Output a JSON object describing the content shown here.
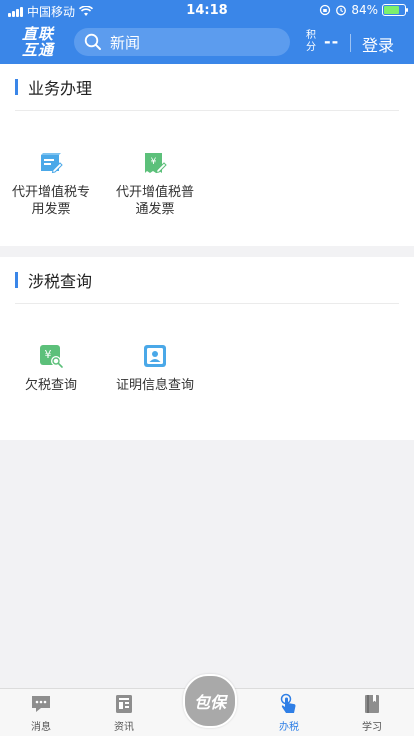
{
  "status_bar": {
    "carrier": "中国移动",
    "time": "14:18",
    "battery": "84%",
    "battery_level": 0.84
  },
  "app_bar": {
    "logo_line1": "直联",
    "logo_line2": "互通",
    "search_placeholder": "新闻",
    "points_label": "积分",
    "points_value": "--",
    "login_label": "登录"
  },
  "sections": [
    {
      "title": "业务办理",
      "items": [
        {
          "label": "代开增值税专用发票",
          "icon": "invoice-special-icon",
          "color": "#4aa8e8"
        },
        {
          "label": "代开增值税普通发票",
          "icon": "invoice-general-icon",
          "color": "#5cc07a"
        }
      ]
    },
    {
      "title": "涉税查询",
      "items": [
        {
          "label": "欠税查询",
          "icon": "tax-arrears-search-icon",
          "color": "#5cc07a"
        },
        {
          "label": "证明信息查询",
          "icon": "certificate-person-icon",
          "color": "#4aa8e8"
        }
      ]
    }
  ],
  "tab_bar": {
    "tabs": [
      {
        "label": "消息",
        "icon": "message-icon"
      },
      {
        "label": "资讯",
        "icon": "news-icon"
      },
      {
        "label": "包保",
        "icon": "center-badge"
      },
      {
        "label": "办税",
        "icon": "tap-hand-icon",
        "active": true
      },
      {
        "label": "学习",
        "icon": "book-icon"
      }
    ]
  },
  "colors": {
    "primary": "#3a86e8",
    "active_tab": "#2f7fe6",
    "background": "#f2f2f4"
  }
}
